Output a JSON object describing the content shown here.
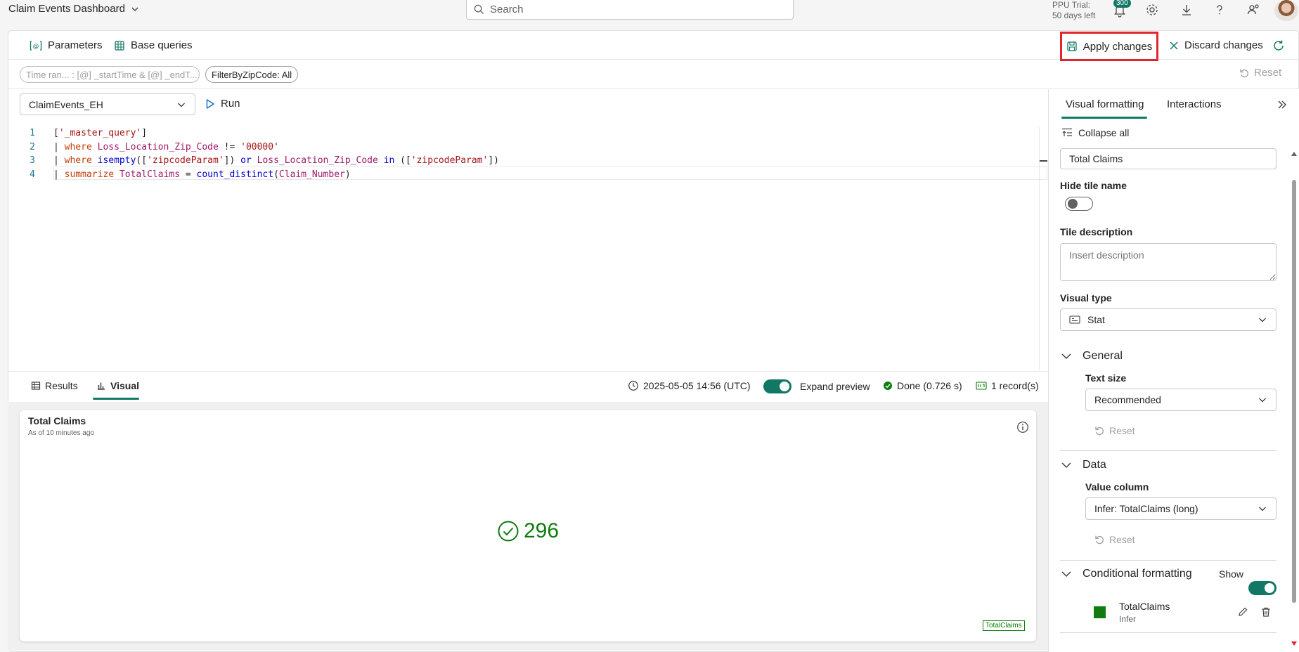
{
  "app": {
    "title": "Claim Events Dashboard"
  },
  "search": {
    "placeholder": "Search"
  },
  "trial": {
    "line1": "PPU Trial:",
    "line2": "50 days left",
    "notifications": "300"
  },
  "toolbar": {
    "parameters": "Parameters",
    "base_queries": "Base queries",
    "apply": "Apply changes",
    "discard": "Discard changes"
  },
  "filters": {
    "time_range": "Time ran... : [@] _startTime  & [@] _endT...",
    "zip": "FilterByZipCode: All",
    "reset": "Reset"
  },
  "editor": {
    "database": "ClaimEvents_EH",
    "run": "Run",
    "lines": [
      {
        "num": "1",
        "tokens": [
          [
            "plain",
            "["
          ],
          [
            "str",
            "'_master_query'"
          ],
          [
            "plain",
            "]"
          ]
        ]
      },
      {
        "num": "2",
        "tokens": [
          [
            "plain",
            "| "
          ],
          [
            "kw",
            "where"
          ],
          [
            "plain",
            " "
          ],
          [
            "col",
            "Loss_Location_Zip_Code"
          ],
          [
            "plain",
            " != "
          ],
          [
            "str",
            "'00000'"
          ]
        ]
      },
      {
        "num": "3",
        "tokens": [
          [
            "plain",
            "| "
          ],
          [
            "kw",
            "where"
          ],
          [
            "plain",
            " "
          ],
          [
            "fn",
            "isempty"
          ],
          [
            "plain",
            "(["
          ],
          [
            "str",
            "'zipcodeParam'"
          ],
          [
            "plain",
            "]) "
          ],
          [
            "fn",
            "or"
          ],
          [
            "plain",
            " "
          ],
          [
            "col",
            "Loss_Location_Zip_Code"
          ],
          [
            "plain",
            " "
          ],
          [
            "fn",
            "in"
          ],
          [
            "plain",
            " (["
          ],
          [
            "str",
            "'zipcodeParam'"
          ],
          [
            "plain",
            "])"
          ]
        ]
      },
      {
        "num": "4",
        "tokens": [
          [
            "plain",
            "| "
          ],
          [
            "kw",
            "summarize"
          ],
          [
            "plain",
            " "
          ],
          [
            "col",
            "TotalClaims"
          ],
          [
            "plain",
            " = "
          ],
          [
            "fn",
            "count_distinct"
          ],
          [
            "plain",
            "("
          ],
          [
            "col",
            "Claim_Number"
          ],
          [
            "plain",
            ")"
          ]
        ]
      }
    ]
  },
  "results": {
    "tab_results": "Results",
    "tab_visual": "Visual",
    "timestamp": "2025-05-05 14:56 (UTC)",
    "expand_preview": "Expand preview",
    "status": "Done (0.726 s)",
    "records": "1 record(s)"
  },
  "tile": {
    "title": "Total Claims",
    "subtitle": "As of 10 minutes ago",
    "value": "296",
    "legend": "TotalClaims",
    "value_color": "#107c10"
  },
  "pane": {
    "tab_visual_formatting": "Visual formatting",
    "tab_interactions": "Interactions",
    "collapse_all": "Collapse all",
    "tile_name_value": "Total Claims",
    "hide_tile_name_label": "Hide tile name",
    "hide_tile_name_on": false,
    "tile_description_label": "Tile description",
    "tile_description_placeholder": "Insert description",
    "visual_type_label": "Visual type",
    "visual_type_value": "Stat",
    "general_title": "General",
    "text_size_label": "Text size",
    "text_size_value": "Recommended",
    "reset": "Reset",
    "data_title": "Data",
    "value_column_label": "Value column",
    "value_column_value": "Infer: TotalClaims (long)",
    "conditional_title": "Conditional formatting",
    "show_label": "Show",
    "show_on": true,
    "rule_name": "TotalClaims",
    "rule_sub": "Infer",
    "rule_color": "#107c10"
  },
  "colors": {
    "accent": "#117865",
    "highlight_border": "#e3242b"
  }
}
